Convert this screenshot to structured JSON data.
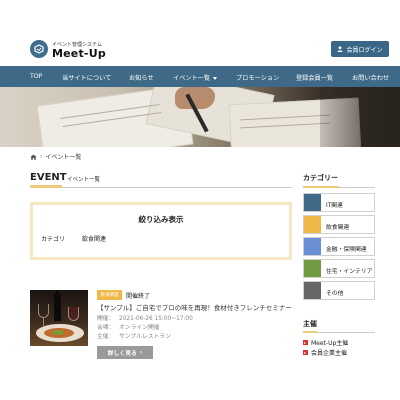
{
  "header": {
    "logo_sub": "イベント管理システム",
    "logo_title": "Meet-Up",
    "login_label": "会員ログイン"
  },
  "nav": {
    "items": [
      "TOP",
      "当サイトについて",
      "お知らせ",
      "イベント一覧",
      "プロモーション",
      "登録会員一覧",
      "お問い合わせ"
    ]
  },
  "breadcrumb": {
    "current": "イベント一覧"
  },
  "main": {
    "heading": "EVENT",
    "subheading": "イベント一覧",
    "filter": {
      "title": "絞り込み表示",
      "label": "カテゴリ",
      "value": "飲食関連"
    },
    "event": {
      "badge": "飲食関連",
      "status": "開催終了",
      "title": "【サンプル】ご自宅でプロの味を再現！食材付きフレンチセミナー",
      "date_label": "開催：",
      "date_value": "2021-06-26 15:00~17:00",
      "venue_label": "会場：",
      "venue_value": "オンライン開催",
      "host_label": "主催：",
      "host_value": "サンプルレストラン",
      "more_label": "詳しく見る"
    }
  },
  "sidebar": {
    "category_heading": "カテゴリー",
    "categories": [
      {
        "label": "IT関連",
        "color": "#3e6a87"
      },
      {
        "label": "飲食関連",
        "color": "#f0b848"
      },
      {
        "label": "金融・保険関連",
        "color": "#6b8fd6"
      },
      {
        "label": "住宅・インテリア",
        "color": "#6f9a3f"
      },
      {
        "label": "その他",
        "color": "#666666"
      }
    ],
    "organizer_heading": "主催",
    "organizers": [
      "Meet-Up主催",
      "会員企業主催"
    ]
  },
  "colors": {
    "brand": "#3e6a87",
    "accent": "#f2c879",
    "badge": "#f0b848",
    "more_button": "#9a9a9a"
  }
}
